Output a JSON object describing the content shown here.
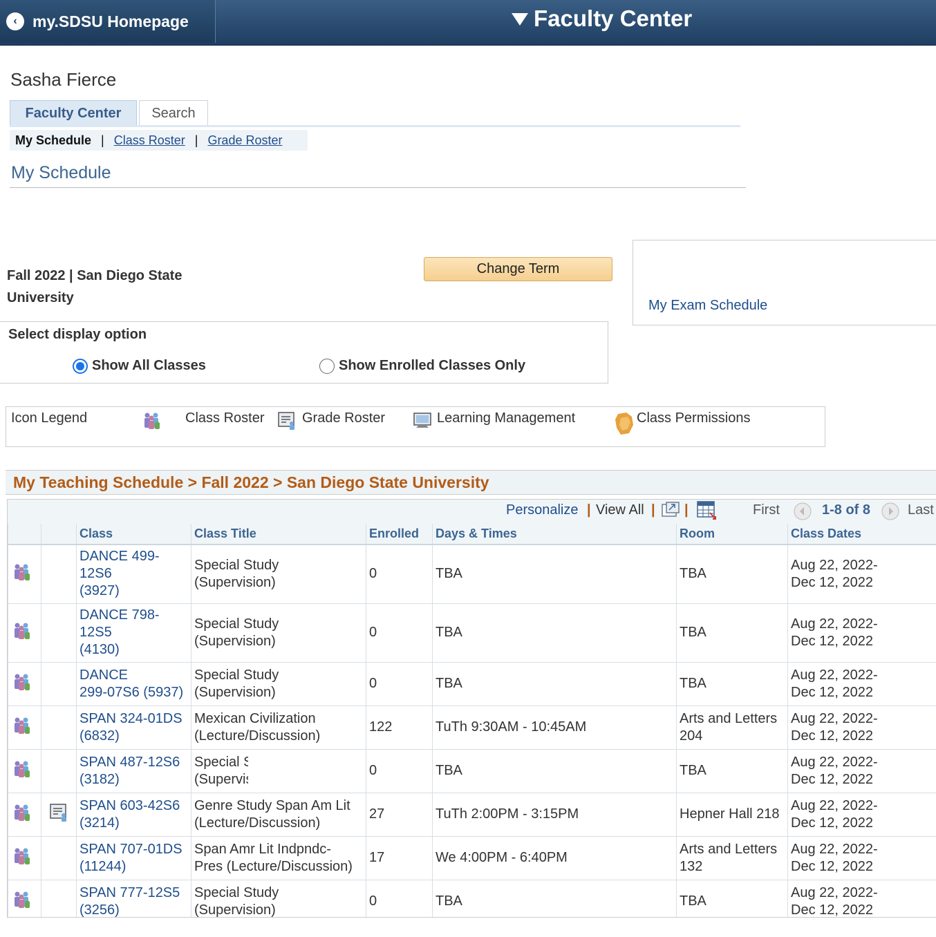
{
  "header": {
    "back_label": "my.SDSU Homepage",
    "title": "Faculty Center"
  },
  "user": {
    "name": "Sasha Fierce"
  },
  "tabs": [
    {
      "label": "Faculty Center",
      "active": true
    },
    {
      "label": "Search",
      "active": false
    }
  ],
  "subnav": {
    "current": "My Schedule",
    "separator": "|",
    "links": [
      "Class Roster",
      "Grade Roster"
    ]
  },
  "page_heading": "My Schedule",
  "term": {
    "line1": "Fall 2022 | San Diego State",
    "line2": "University",
    "change_button": "Change Term"
  },
  "exam_link": "My Exam Schedule",
  "display_option": {
    "title": "Select display option",
    "options": [
      {
        "label": "Show All Classes",
        "selected": true
      },
      {
        "label": "Show Enrolled Classes Only",
        "selected": false
      }
    ]
  },
  "legend": {
    "title": "Icon Legend",
    "items": [
      "Class Roster",
      "Grade Roster",
      "Learning Management",
      "Class Permissions"
    ]
  },
  "schedule": {
    "title": "My Teaching Schedule > Fall 2022 > San Diego State University",
    "nav": {
      "personalize": "Personalize",
      "view_all": "View All",
      "first": "First",
      "range": "1-8 of 8",
      "last": "Last",
      "sep": "|"
    },
    "columns": [
      "Class",
      "Class Title",
      "Enrolled",
      "Days & Times",
      "Room",
      "Class Dates"
    ],
    "rows": [
      {
        "has_grade_icon": false,
        "class_l1": "DANCE 499-",
        "class_l2": "12S6",
        "class_l3": "(3927)",
        "title_l1": "Special Study",
        "title_l2": "(Supervision)",
        "enrolled": "0",
        "days": "TBA",
        "room_l1": "TBA",
        "room_l2": "",
        "dates_l1": "Aug 22, 2022-",
        "dates_l2": "Dec 12, 2022"
      },
      {
        "has_grade_icon": false,
        "class_l1": "DANCE 798-",
        "class_l2": "12S5",
        "class_l3": "(4130)",
        "title_l1": "Special Study",
        "title_l2": "(Supervision)",
        "enrolled": "0",
        "days": "TBA",
        "room_l1": "TBA",
        "room_l2": "",
        "dates_l1": "Aug 22, 2022-",
        "dates_l2": "Dec 12, 2022"
      },
      {
        "has_grade_icon": false,
        "class_l1": "DANCE",
        "class_l2": "299-07S6 (5937)",
        "class_l3": "",
        "title_l1": "Special Study",
        "title_l2": "(Supervision)",
        "enrolled": "0",
        "days": "TBA",
        "room_l1": "TBA",
        "room_l2": "",
        "dates_l1": "Aug 22, 2022-",
        "dates_l2": "Dec 12, 2022"
      },
      {
        "has_grade_icon": false,
        "class_l1": "SPAN 324-01DS",
        "class_l2": "(6832)",
        "class_l3": "",
        "title_l1": "Mexican Civilization",
        "title_l2": "(Lecture/Discussion)",
        "enrolled": "122",
        "days": "TuTh 9:30AM - 10:45AM",
        "room_l1": "Arts and Letters",
        "room_l2": "204",
        "dates_l1": "Aug 22, 2022-",
        "dates_l2": "Dec 12, 2022"
      },
      {
        "has_grade_icon": false,
        "class_l1": "SPAN 487-12S6",
        "class_l2": "(3182)",
        "class_l3": "",
        "title_l1": "Special Study",
        "title_l2": "(Supervision)",
        "enrolled": "0",
        "days": "TBA",
        "room_l1": "TBA",
        "room_l2": "",
        "dates_l1": "Aug 22, 2022-",
        "dates_l2": "Dec 12, 2022",
        "title_clipped": true
      },
      {
        "has_grade_icon": true,
        "class_l1": "SPAN 603-42S6",
        "class_l2": "(3214)",
        "class_l3": "",
        "title_l1": "Genre Study Span Am Lit",
        "title_l2": "(Lecture/Discussion)",
        "enrolled": "27",
        "days": "TuTh 2:00PM - 3:15PM",
        "room_l1": "Hepner Hall 218",
        "room_l2": "",
        "dates_l1": "Aug 22, 2022-",
        "dates_l2": "Dec 12, 2022"
      },
      {
        "has_grade_icon": false,
        "class_l1": "SPAN 707-01DS",
        "class_l2": "(11244)",
        "class_l3": "",
        "title_l1": "Span Amr Lit Indpndc-",
        "title_l2": "Pres (Lecture/Discussion)",
        "enrolled": "17",
        "days": "We 4:00PM - 6:40PM",
        "room_l1": "Arts and Letters",
        "room_l2": "132",
        "dates_l1": "Aug 22, 2022-",
        "dates_l2": "Dec 12, 2022"
      },
      {
        "has_grade_icon": false,
        "class_l1": "SPAN 777-12S5",
        "class_l2": "(3256)",
        "class_l3": "",
        "title_l1": "Special Study",
        "title_l2": "(Supervision)",
        "enrolled": "0",
        "days": "TBA",
        "room_l1": "TBA",
        "room_l2": "",
        "dates_l1": "Aug 22, 2022-",
        "dates_l2": "Dec 12, 2022"
      }
    ]
  }
}
